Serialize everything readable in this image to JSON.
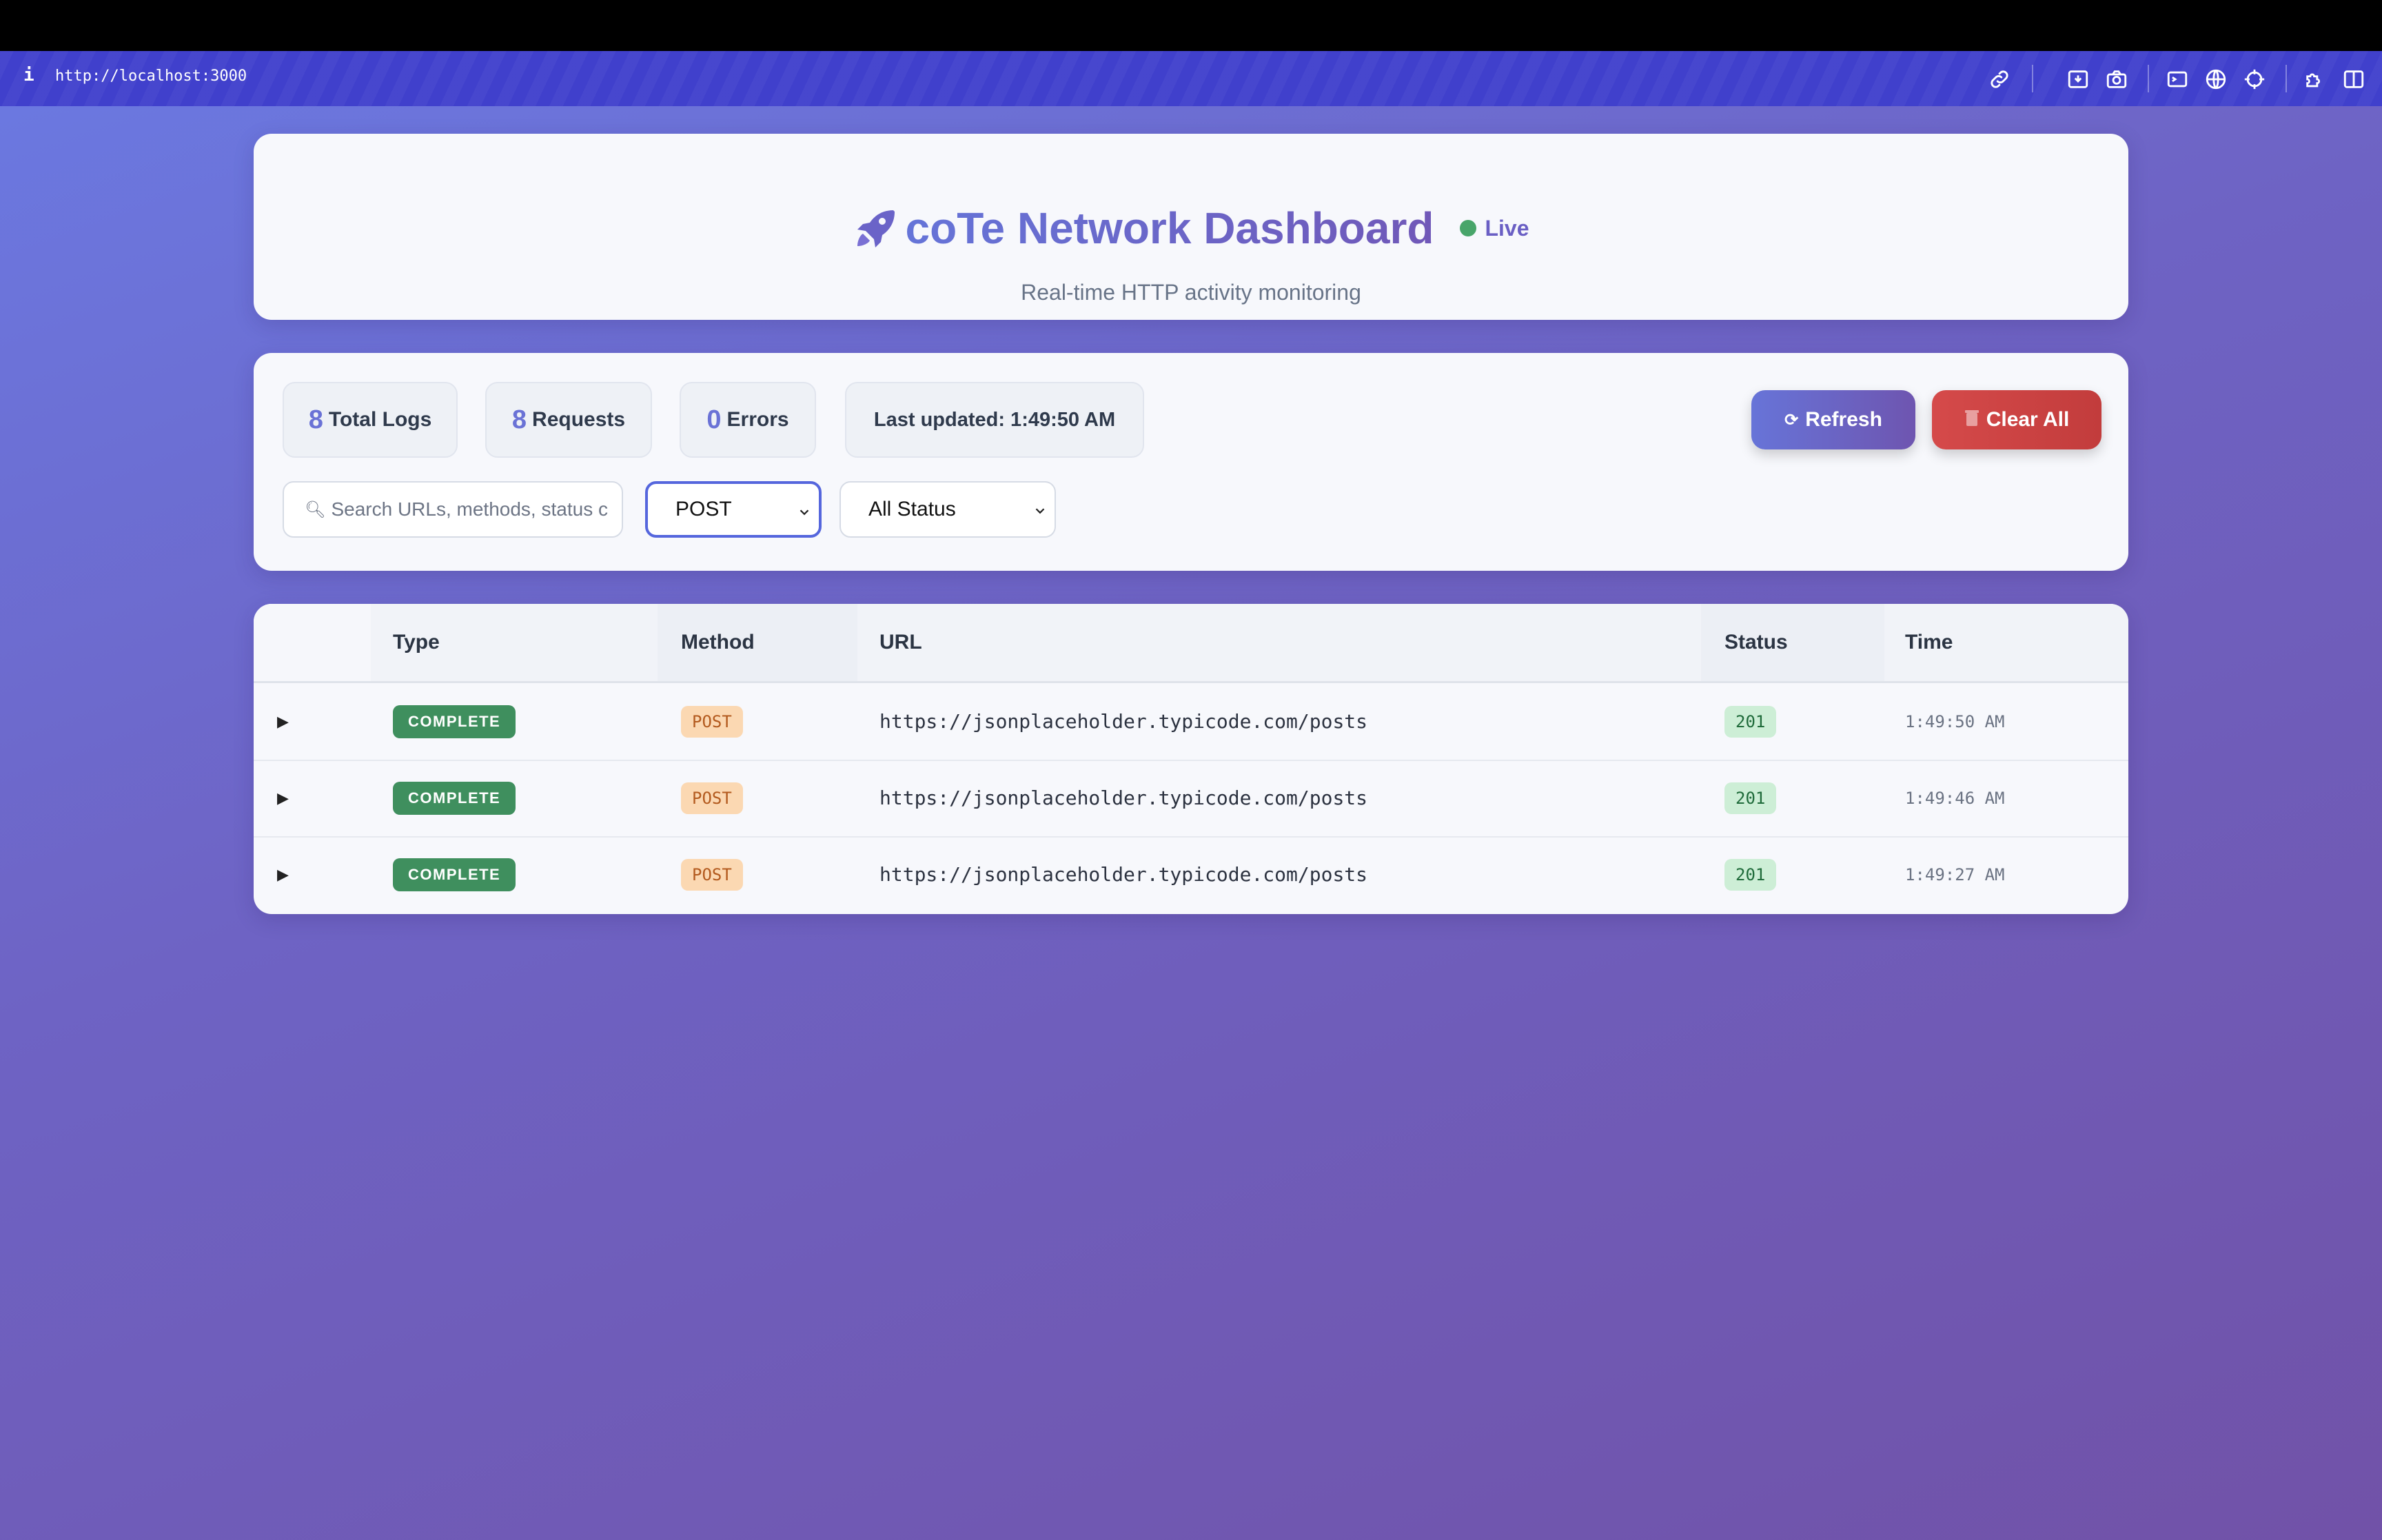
{
  "browser": {
    "info_glyph": "i",
    "url": "http://localhost:3000"
  },
  "header": {
    "title": "coTe Network Dashboard",
    "live_label": "Live",
    "subtitle": "Real-time HTTP activity monitoring",
    "accent_color": "#6a5fc4",
    "live_dot_color": "#48a56a"
  },
  "stats": {
    "total_logs": {
      "value": "8",
      "label": "Total Logs"
    },
    "requests": {
      "value": "8",
      "label": "Requests"
    },
    "errors": {
      "value": "0",
      "label": "Errors"
    },
    "last_updated": "Last updated: 1:49:50 AM"
  },
  "actions": {
    "refresh_label": "Refresh",
    "refresh_icon": "refresh-icon",
    "clear_label": "Clear All",
    "clear_icon": "trash-icon"
  },
  "filters": {
    "search_placeholder": "Search URLs, methods, status c",
    "method_selected": "POST",
    "status_selected": "All Status"
  },
  "table": {
    "columns": [
      "Type",
      "Method",
      "URL",
      "Status",
      "Time"
    ],
    "rows": [
      {
        "type": "COMPLETE",
        "method": "POST",
        "url": "https://jsonplaceholder.typicode.com/posts",
        "status": "201",
        "time": "1:49:50 AM"
      },
      {
        "type": "COMPLETE",
        "method": "POST",
        "url": "https://jsonplaceholder.typicode.com/posts",
        "status": "201",
        "time": "1:49:46 AM"
      },
      {
        "type": "COMPLETE",
        "method": "POST",
        "url": "https://jsonplaceholder.typicode.com/posts",
        "status": "201",
        "time": "1:49:27 AM"
      }
    ]
  }
}
